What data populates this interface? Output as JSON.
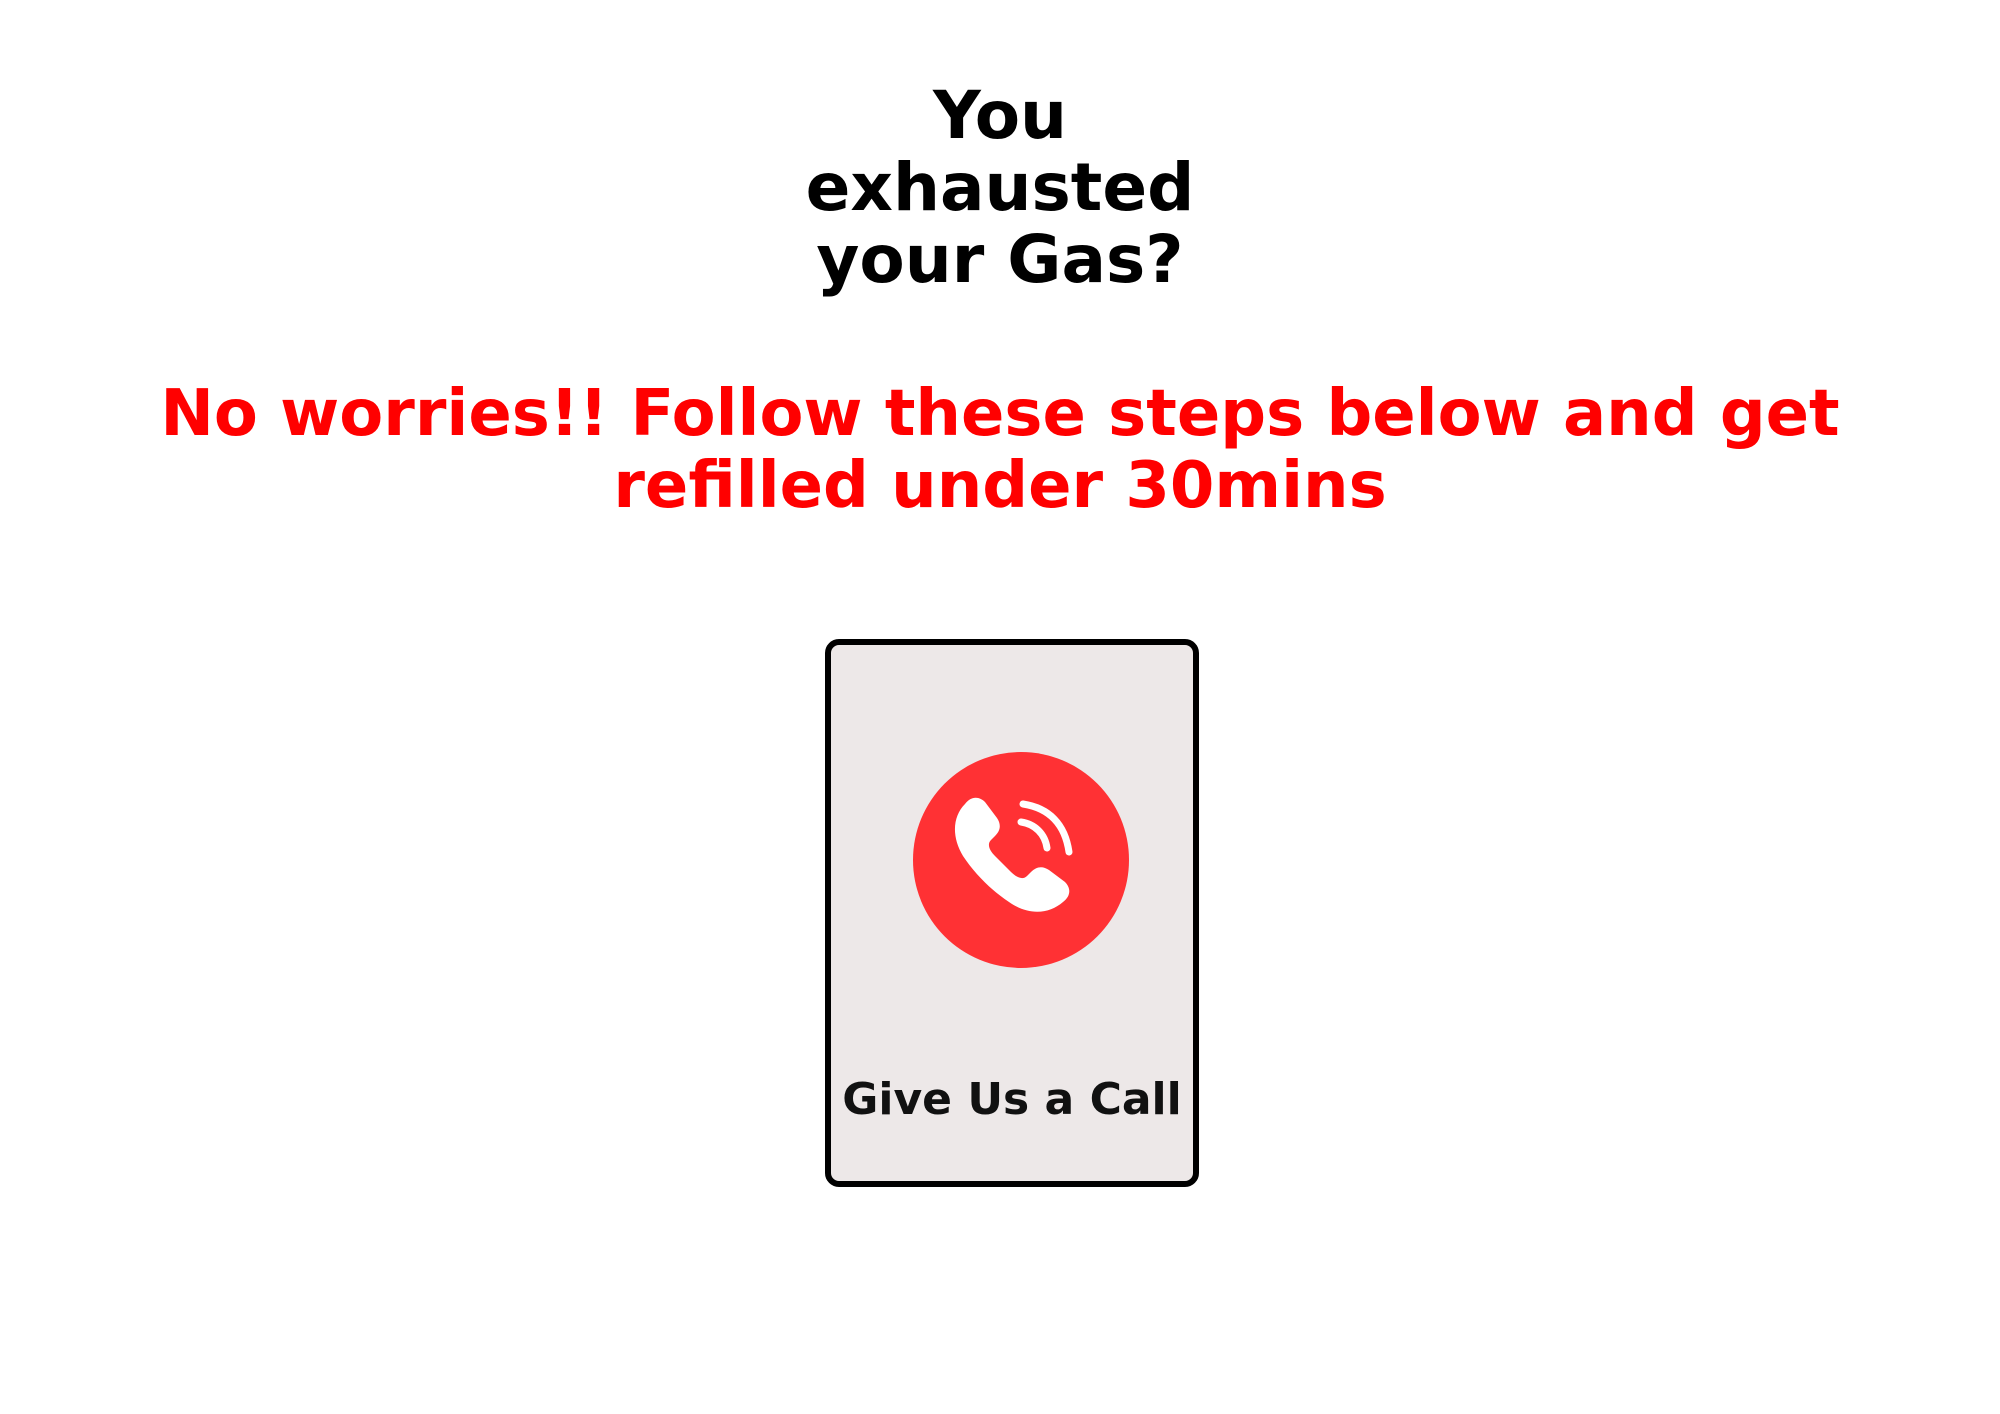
{
  "headline": {
    "lines": [
      "You",
      "exhausted",
      "your Gas?"
    ]
  },
  "subheadline": "No worries!! Follow these steps below and get refilled under 30mins",
  "call_card": {
    "label": "Give Us a Call",
    "icon": "phone-ringing-icon"
  },
  "colors": {
    "background": "#ffffff",
    "headline": "#000000",
    "subheadline": "#ff0000",
    "card_background": "#ede8e8",
    "card_border": "#000000",
    "icon_circle": "#ff3134",
    "icon_glyph": "#ffffff"
  }
}
